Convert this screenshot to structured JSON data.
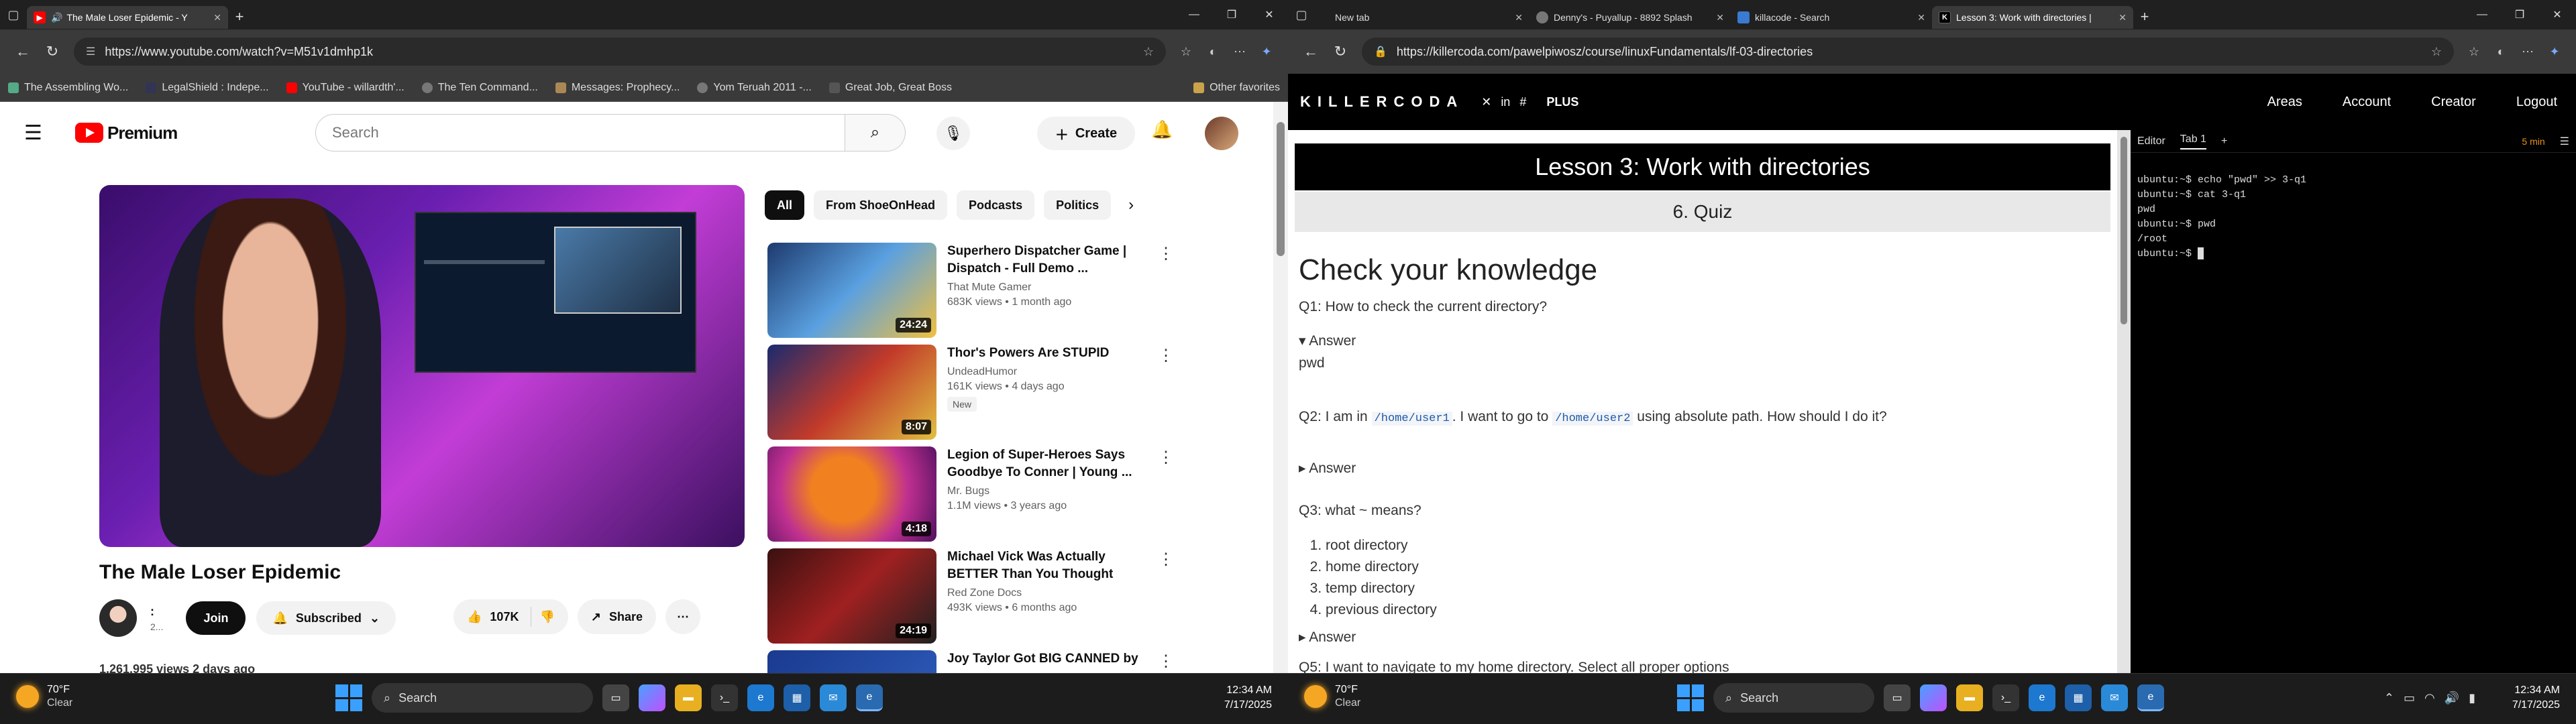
{
  "left_browser": {
    "tabs": [
      {
        "title": "The Male Loser Epidemic - Y",
        "active": true
      }
    ],
    "new_tab": "+",
    "url": "https://www.youtube.com/watch?v=M51v1dmhp1k",
    "favorites": [
      "The Assembling Wo...",
      "LegalShield : Indepe...",
      "YouTube - willardth'...",
      "The Ten Command...",
      "Messages: Prophecy...",
      "Yom Teruah 2011 -...",
      "Great Job, Great Boss"
    ],
    "other_favorites": "Other favorites",
    "youtube": {
      "logo_text": "Premium",
      "search_placeholder": "Search",
      "create_label": "Create",
      "player_timestamp": "",
      "video_title": "The Male Loser Epidemic",
      "channel_name": ":",
      "channel_subs": "2...",
      "join_label": "Join",
      "subscribed_label": "Subscribed",
      "likes": "107K",
      "share_label": "Share",
      "views_line": "1,261,995 views  2 days ago",
      "chips": [
        "All",
        "From ShoeOnHead",
        "Podcasts",
        "Politics"
      ],
      "related": [
        {
          "title": "Superhero Dispatcher Game | Dispatch - Full Demo ...",
          "channel": "That Mute Gamer",
          "meta": "683K views • 1 month ago",
          "duration": "24:24",
          "badge": ""
        },
        {
          "title": "Thor's Powers Are STUPID",
          "channel": "UndeadHumor",
          "meta": "161K views • 4 days ago",
          "duration": "8:07",
          "badge": "New"
        },
        {
          "title": "Legion of Super-Heroes Says Goodbye To Conner | Young ...",
          "channel": "Mr. Bugs",
          "meta": "1.1M views • 3 years ago",
          "duration": "4:18",
          "badge": ""
        },
        {
          "title": "Michael Vick Was Actually BETTER Than You Thought",
          "channel": "Red Zone Docs",
          "meta": "493K views • 6 months ago",
          "duration": "24:19",
          "badge": ""
        },
        {
          "title": "Joy Taylor Got BIG CANNED by",
          "channel": "",
          "meta": "",
          "duration": "",
          "badge": ""
        }
      ]
    }
  },
  "right_browser": {
    "tabs": [
      {
        "title": "New tab",
        "active": false
      },
      {
        "title": "Denny's - Puyallup - 8892 Splash",
        "active": false
      },
      {
        "title": "killacode - Search",
        "active": false
      },
      {
        "title": "Lesson 3: Work with directories |",
        "active": true
      }
    ],
    "url": "https://killercoda.com/pawelpiwosz/course/linuxFundamentals/lf-03-directories",
    "killercoda": {
      "logo": "KILLERCODA",
      "plus": "PLUS",
      "menu": [
        "Areas",
        "Account",
        "Creator",
        "Logout"
      ],
      "lesson_title": "Lesson 3: Work with directories",
      "quiz_title": "6. Quiz",
      "heading": "Check your knowledge",
      "q1": "Q1: How to check the current directory?",
      "answer_label": "Answer",
      "a1": "pwd",
      "q2_pre": "Q2: I am in",
      "q2_code1": "/home/user1",
      "q2_mid": ". I want to go to",
      "q2_code2": "/home/user2",
      "q2_post": "using absolute path. How should I do it?",
      "q3": "Q3: what ~ means?",
      "q3_options": [
        "root directory",
        "home directory",
        "temp directory",
        "previous directory"
      ],
      "q5": "Q5: I want to navigate to my home directory. Select all proper options",
      "terminal": {
        "tabs": [
          "Editor",
          "Tab 1",
          "+"
        ],
        "timer": "5 min",
        "lines": [
          "ubuntu:~$ echo \"pwd\" >> 3-q1",
          "ubuntu:~$ cat 3-q1",
          "pwd",
          "ubuntu:~$ pwd",
          "/root",
          "ubuntu:~$ "
        ]
      }
    }
  },
  "taskbar_left": {
    "weather_temp": "70°F",
    "weather_cond": "Clear",
    "search_label": "Search",
    "time": "12:34 AM",
    "date": "7/17/2025"
  },
  "taskbar_right": {
    "weather_temp": "70°F",
    "weather_cond": "Clear",
    "search_label": "Search",
    "time": "12:34 AM",
    "date": "7/17/2025"
  }
}
